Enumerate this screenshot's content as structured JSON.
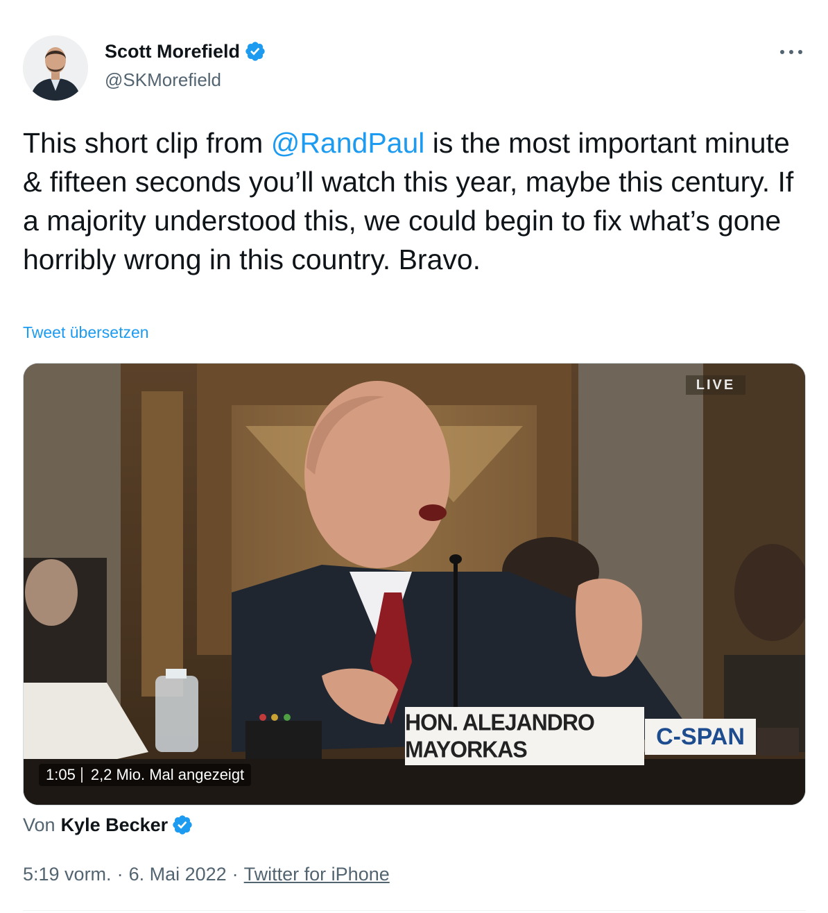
{
  "author": {
    "display_name": "Scott Morefield",
    "handle": "@SKMorefield"
  },
  "tweet": {
    "text_before": "This short clip from ",
    "mention": "@RandPaul",
    "text_after": " is the most important minute & fifteen seconds you’ll watch this year, maybe this century. If a majority understood this, we could begin to fix what’s gone horribly wrong in this country. Bravo.",
    "translate_label": "Tweet übersetzen"
  },
  "media": {
    "live_label": "LIVE",
    "nameplate": "HON. ALEJANDRO MAYORKAS",
    "network_logo": "C-SPAN",
    "duration": "1:05",
    "views": "2,2 Mio. Mal angezeigt"
  },
  "attribution": {
    "prefix": "Von",
    "author": "Kyle Becker"
  },
  "meta": {
    "time": "5:19 vorm.",
    "separator": "·",
    "date": "6. Mai 2022",
    "source": "Twitter for iPhone"
  },
  "icons": {
    "verified": "verified-badge-icon",
    "more": "more-options-icon"
  },
  "colors": {
    "accent": "#1d9bf0",
    "text": "#0f1419",
    "secondary": "#536471"
  }
}
